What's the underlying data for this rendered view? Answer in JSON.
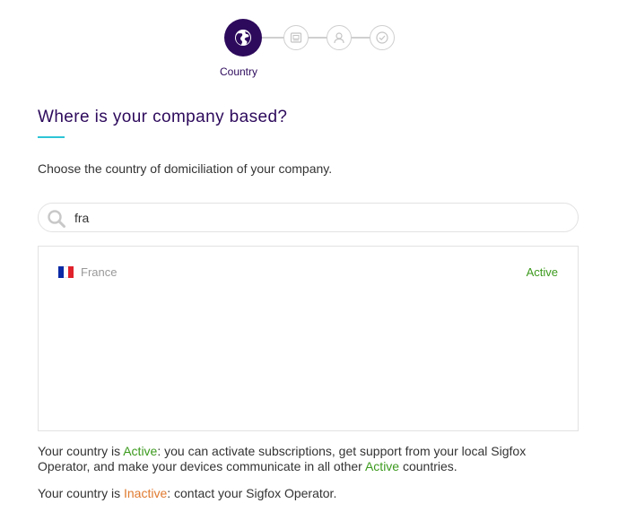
{
  "stepper": {
    "steps": [
      {
        "icon": "globe-icon",
        "state": "active",
        "label": "Country"
      },
      {
        "icon": "id-card-icon",
        "state": "pending"
      },
      {
        "icon": "user-icon",
        "state": "pending"
      },
      {
        "icon": "check-circle-icon",
        "state": "pending"
      }
    ],
    "active_label": "Country"
  },
  "heading": {
    "title": "Where is your company based?",
    "subtitle": "Choose the country of domiciliation of your company."
  },
  "search": {
    "value": "fra",
    "icon": "search-icon"
  },
  "results": [
    {
      "flag": "france-flag-icon",
      "name": "France",
      "status": "Active"
    }
  ],
  "notes": {
    "active": {
      "prefix": "Your country is ",
      "keyword": "Active",
      "middle": ": you can activate subscriptions, get support from your local Sigfox Operator, and make your devices communicate in all other ",
      "keyword2": "Active",
      "suffix": " countries."
    },
    "inactive": {
      "prefix": "Your country is ",
      "keyword": "Inactive",
      "suffix": ": contact your Sigfox Operator."
    }
  },
  "colors": {
    "brand": "#2d0a5c",
    "accent_underline": "#2ec4d6",
    "active_status": "#3c9a1e",
    "inactive_status": "#e07a2f",
    "muted_text": "#999999",
    "step_border": "#cfcfcf"
  }
}
